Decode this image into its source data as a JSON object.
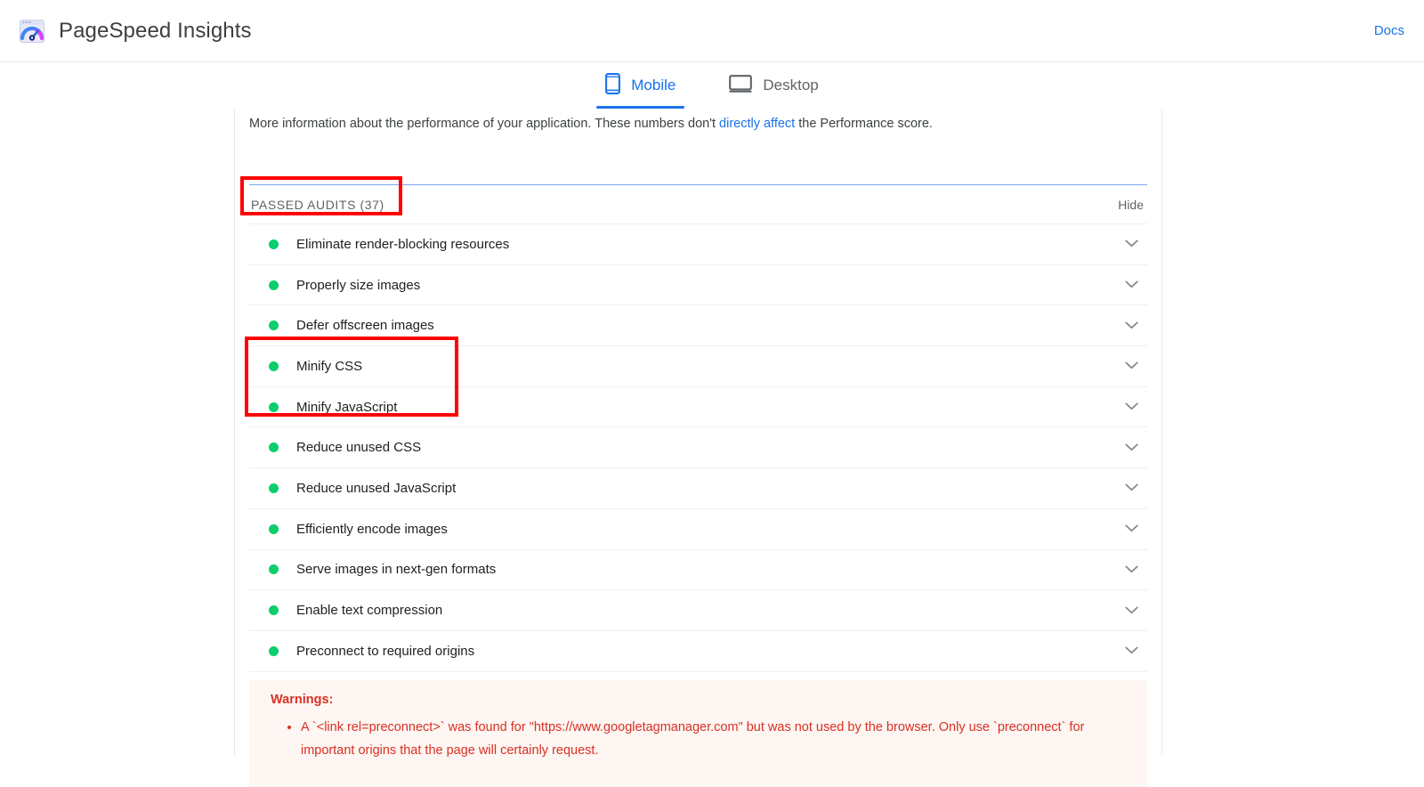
{
  "header": {
    "logo_icon": "pagespeed-insights-logo",
    "title": "PageSpeed Insights",
    "docs_label": "Docs"
  },
  "tabs": [
    {
      "id": "mobile",
      "label": "Mobile",
      "icon": "mobile-phone-icon",
      "active": true
    },
    {
      "id": "desktop",
      "label": "Desktop",
      "icon": "desktop-monitor-icon",
      "active": false
    }
  ],
  "main": {
    "intro": {
      "before_link": "More information about the performance of your application. These numbers don't ",
      "link_text": "directly affect",
      "after_link": " the Performance score."
    },
    "passed_audits": {
      "title": "PASSED AUDITS (37)",
      "count": 37,
      "hide_label": "Hide",
      "items": [
        {
          "label": "Eliminate render-blocking resources",
          "status": "pass"
        },
        {
          "label": "Properly size images",
          "status": "pass"
        },
        {
          "label": "Defer offscreen images",
          "status": "pass"
        },
        {
          "label": "Minify CSS",
          "status": "pass"
        },
        {
          "label": "Minify JavaScript",
          "status": "pass"
        },
        {
          "label": "Reduce unused CSS",
          "status": "pass"
        },
        {
          "label": "Reduce unused JavaScript",
          "status": "pass"
        },
        {
          "label": "Efficiently encode images",
          "status": "pass"
        },
        {
          "label": "Serve images in next-gen formats",
          "status": "pass"
        },
        {
          "label": "Enable text compression",
          "status": "pass"
        },
        {
          "label": "Preconnect to required origins",
          "status": "pass"
        }
      ]
    },
    "warnings": {
      "title": "Warnings:",
      "items": [
        "A `<link rel=preconnect>` was found for \"https://www.googletagmanager.com\" but was not used by the browser. Only use `preconnect` for important origins that the page will certainly request."
      ]
    }
  },
  "annotations": [
    {
      "id": "annot-passed",
      "target": "passed-audits-title",
      "color": "#ff0000"
    },
    {
      "id": "annot-minify",
      "target": "minify-css-and-javascript-rows",
      "color": "#ff0000"
    }
  ],
  "colors": {
    "accent_blue": "#1a73e8",
    "pass_green": "#0cce6b",
    "warning_red": "#d93025",
    "annotation_red": "#ff0000",
    "text_primary": "#202124",
    "text_secondary": "#5f6368",
    "divider": "#eceff1"
  }
}
